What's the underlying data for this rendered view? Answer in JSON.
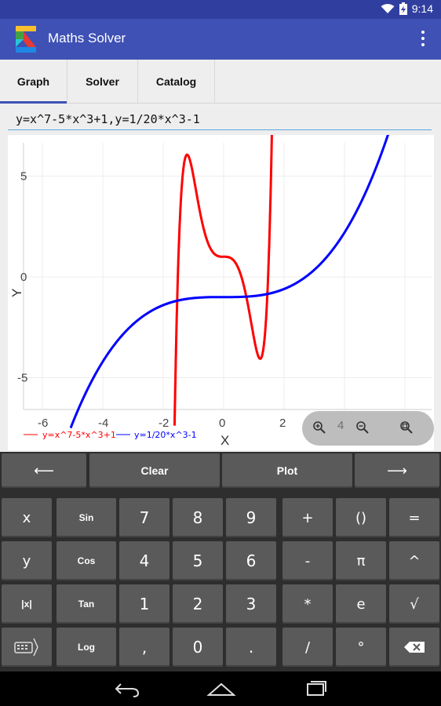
{
  "status_bar": {
    "time": "9:14"
  },
  "app_bar": {
    "title": "Maths Solver"
  },
  "tabs": [
    {
      "label": "Graph",
      "active": true
    },
    {
      "label": "Solver",
      "active": false
    },
    {
      "label": "Catalog",
      "active": false
    }
  ],
  "expression": {
    "value": "y=x^7-5*x^3+1,y=1/20*x^3-1"
  },
  "graph": {
    "x_label": "X",
    "y_label": "Y",
    "x_ticks": [
      "-6",
      "-4",
      "-2",
      "0",
      "2"
    ],
    "y_ticks": [
      "5",
      "0",
      "-5"
    ],
    "legend": [
      {
        "label": "y=x^7-5*x^3+1",
        "color": "#ff0000"
      },
      {
        "label": "y=1/20*x^3-1",
        "color": "#0000ff"
      }
    ],
    "zoom_level": "4"
  },
  "keyboard": {
    "row1": [
      {
        "label": "⟵",
        "name": "cursor-left-key"
      },
      {
        "label": "Clear",
        "name": "clear-key"
      },
      {
        "label": "Plot",
        "name": "plot-key"
      },
      {
        "label": "⟶",
        "name": "cursor-right-key"
      }
    ],
    "rows": [
      [
        "x",
        "Sin",
        "7",
        "8",
        "9",
        "+",
        "()",
        "="
      ],
      [
        "y",
        "Cos",
        "4",
        "5",
        "6",
        "-",
        "π",
        "^"
      ],
      [
        "|x|",
        "Tan",
        "1",
        "2",
        "3",
        "*",
        "e",
        "√"
      ],
      [
        "",
        "Log",
        ",",
        "0",
        ".",
        "/",
        "°",
        ""
      ]
    ]
  },
  "colors": {
    "primary": "#3f51b5",
    "primary_dark": "#303f9f",
    "curve_red": "#ff0000",
    "curve_blue": "#0000ff",
    "key_bg": "#5a5a5a"
  },
  "chart_data": {
    "type": "line",
    "x_ticks": [
      -6,
      -4,
      -2,
      0,
      2
    ],
    "y_ticks": [
      5,
      0,
      -5
    ],
    "xlim": [
      -6.6,
      6.5
    ],
    "ylim": [
      -6.8,
      7
    ],
    "xlabel": "X",
    "ylabel": "Y",
    "grid": true,
    "legend_position": "bottom-left",
    "series": [
      {
        "name": "y=x^7-5*x^3+1",
        "expression": "x^7-5*x^3+1",
        "color": "#ff0000"
      },
      {
        "name": "y=1/20*x^3-1",
        "expression": "1/20*x^3-1",
        "color": "#0000ff"
      }
    ]
  }
}
